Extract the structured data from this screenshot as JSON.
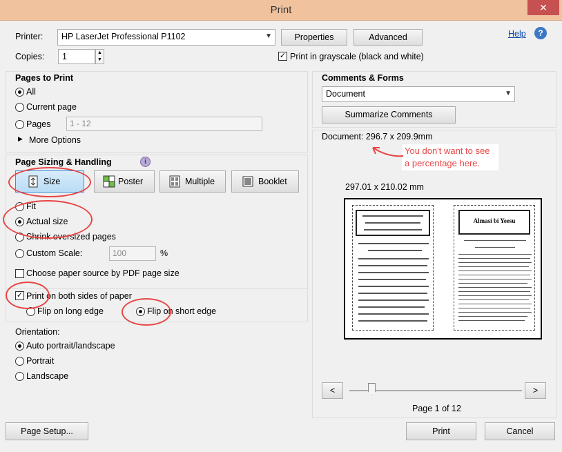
{
  "window": {
    "title": "Print",
    "close_glyph": "✕"
  },
  "printer": {
    "label": "Printer:",
    "selected": "HP LaserJet Professional P1102",
    "properties": "Properties",
    "advanced": "Advanced",
    "help": "Help"
  },
  "copies": {
    "label": "Copies:",
    "value": "1"
  },
  "grayscale": {
    "label": "Print in grayscale (black and white)",
    "checked": true
  },
  "pages_to_print": {
    "heading": "Pages to Print",
    "all": "All",
    "current": "Current page",
    "pages": "Pages",
    "pages_value": "1 - 12",
    "more_options": "More Options"
  },
  "sizing": {
    "heading": "Page Sizing & Handling",
    "tabs": [
      "Size",
      "Poster",
      "Multiple",
      "Booklet"
    ],
    "fit": "Fit",
    "actual": "Actual size",
    "shrink": "Shrink oversized pages",
    "custom": "Custom Scale:",
    "custom_value": "100",
    "percent": "%",
    "paper_source": "Choose paper source by PDF page size",
    "both_sides": "Print on both sides of paper",
    "long_edge": "Flip on long edge",
    "short_edge": "Flip on short edge"
  },
  "orientation": {
    "heading": "Orientation:",
    "auto": "Auto portrait/landscape",
    "portrait": "Portrait",
    "landscape": "Landscape"
  },
  "comments": {
    "heading": "Comments & Forms",
    "selected": "Document",
    "summarize": "Summarize Comments"
  },
  "preview": {
    "document_size": "Document: 296.7 x 209.9mm",
    "annotation": "You don't want to see a percentage here.",
    "paper_size": "297.01 x 210.02 mm",
    "right_title": "Almasi bi Yeesu",
    "page_indicator": "Page 1 of 12",
    "prev": "<",
    "next": ">"
  },
  "footer": {
    "page_setup": "Page Setup...",
    "print": "Print",
    "cancel": "Cancel"
  },
  "colors": {
    "annotation": "#e84545",
    "titlebar": "#f0c29d",
    "help_link": "#0645ad"
  }
}
